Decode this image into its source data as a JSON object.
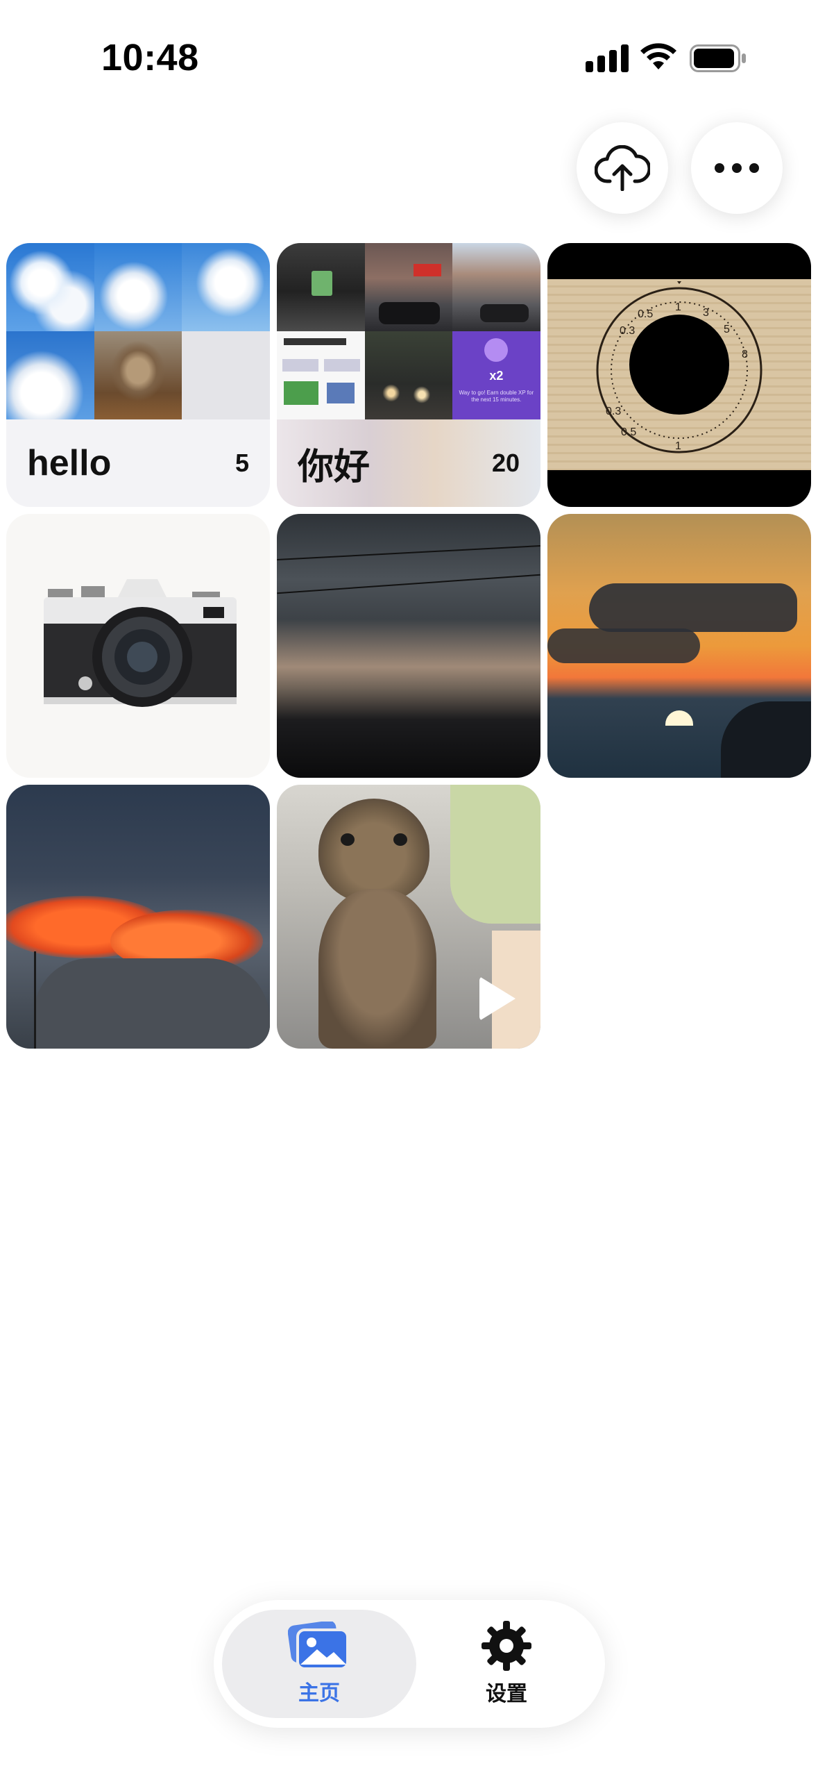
{
  "status_bar": {
    "time": "10:48"
  },
  "top_actions": {
    "upload_icon": "cloud-upload-icon",
    "more_icon": "ellipsis-icon"
  },
  "albums": [
    {
      "name": "hello",
      "count": "5"
    },
    {
      "name": "你好",
      "count": "20"
    }
  ],
  "album2_thumbs": {
    "dark_tile_text": "x2",
    "dark_tile_caption": "Way to go! Earn double XP for the next 15 minutes."
  },
  "dial_labels": [
    "0.3",
    "0.5",
    "1",
    "3",
    "5",
    "8",
    "0.3",
    "0.5",
    "1"
  ],
  "tab_bar": {
    "tabs": [
      {
        "label": "主页",
        "icon": "photos-icon",
        "selected": true
      },
      {
        "label": "设置",
        "icon": "gear-icon",
        "selected": false
      }
    ]
  },
  "colors": {
    "accent": "#3b73e6",
    "tab_selected_bg": "#ececee"
  }
}
